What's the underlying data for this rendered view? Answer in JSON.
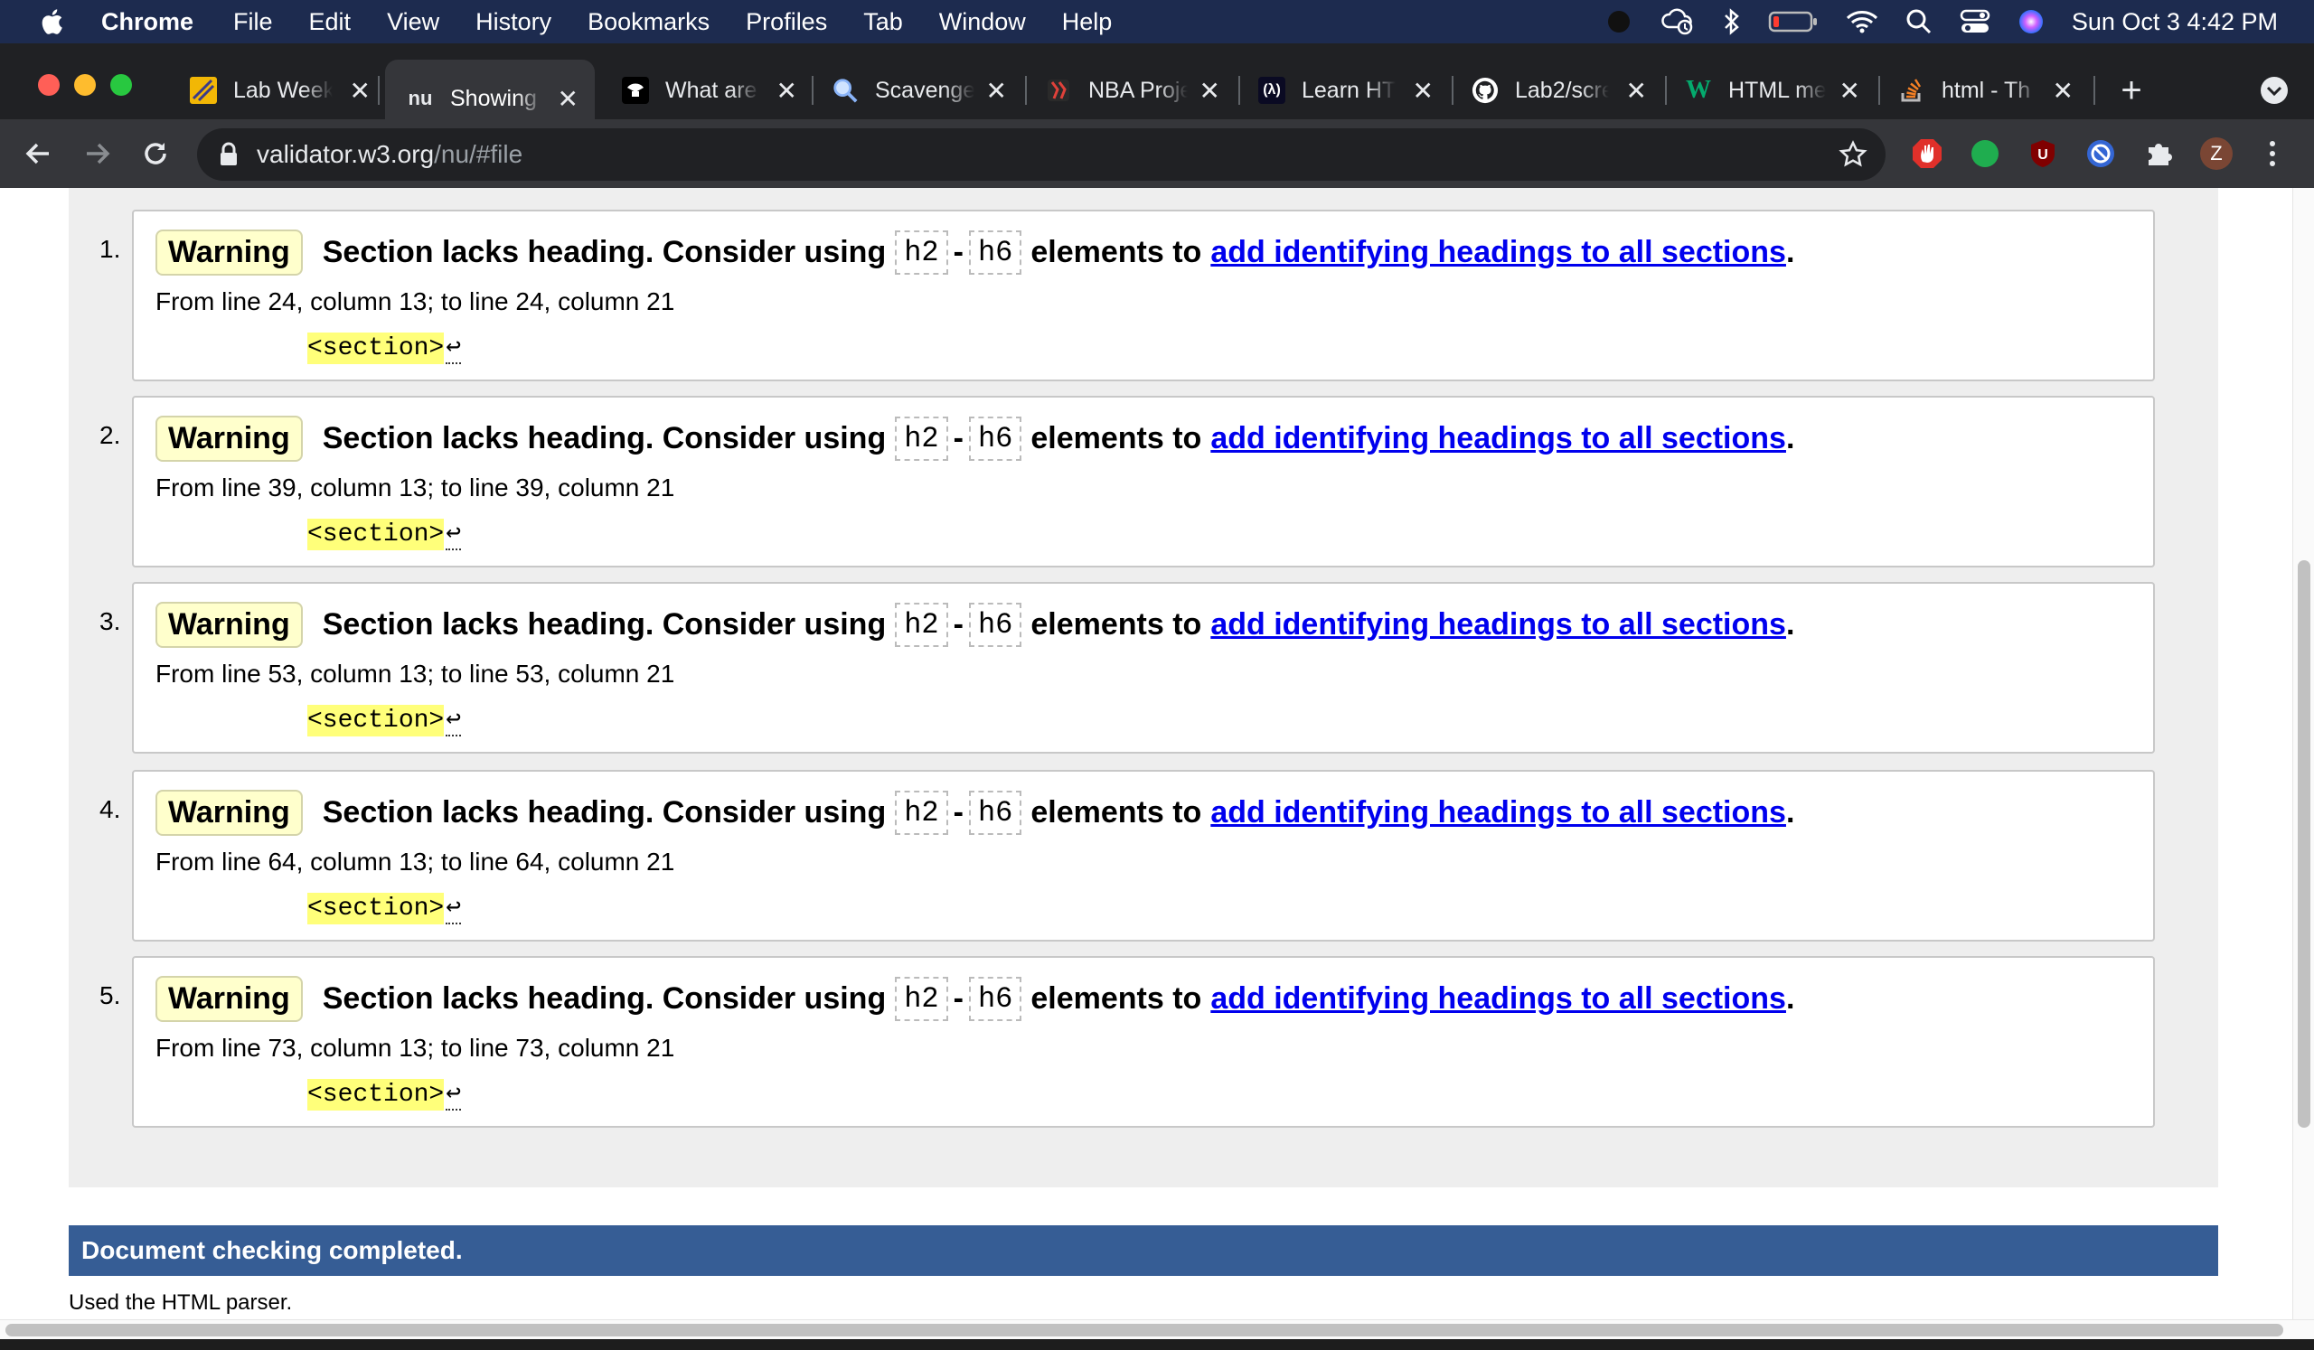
{
  "menubar": {
    "app_name": "Chrome",
    "items": [
      "File",
      "Edit",
      "View",
      "History",
      "Bookmarks",
      "Profiles",
      "Tab",
      "Window",
      "Help"
    ],
    "clock": "Sun Oct 3  4:42 PM"
  },
  "tabs": [
    {
      "title": "Lab Week",
      "icon": "lab-week-icon"
    },
    {
      "title": "Showing r",
      "icon": "nu-icon",
      "favicon_text": "nu",
      "active": true
    },
    {
      "title": "What are",
      "icon": "what-are-icon"
    },
    {
      "title": "Scavenge",
      "icon": "magnifier-icon"
    },
    {
      "title": "NBA Proje",
      "icon": "nba-icon"
    },
    {
      "title": "Learn HTI",
      "icon": "freecodecamp-icon",
      "favicon_text": "(λ)"
    },
    {
      "title": "Lab2/scre",
      "icon": "github-icon"
    },
    {
      "title": "HTML me",
      "icon": "w3schools-icon",
      "favicon_text": "W"
    },
    {
      "title": "html - Th",
      "icon": "stackoverflow-icon"
    }
  ],
  "toolbar": {
    "url_host": "validator.w3.org",
    "url_path": "/nu/#file",
    "profile_initial": "Z"
  },
  "messages": [
    {
      "num": "1.",
      "type": "Warning",
      "text_before": "Section lacks heading. Consider using",
      "code_a": "h2",
      "sep": "-",
      "code_b": "h6",
      "text_after": "elements to",
      "link": "add identifying headings to all sections",
      "period": ".",
      "location": "From line 24, column 13; to line 24, column 21",
      "extract": "<section>",
      "lf": "↩"
    },
    {
      "num": "2.",
      "type": "Warning",
      "text_before": "Section lacks heading. Consider using",
      "code_a": "h2",
      "sep": "-",
      "code_b": "h6",
      "text_after": "elements to",
      "link": "add identifying headings to all sections",
      "period": ".",
      "location": "From line 39, column 13; to line 39, column 21",
      "extract": "<section>",
      "lf": "↩"
    },
    {
      "num": "3.",
      "type": "Warning",
      "text_before": "Section lacks heading. Consider using",
      "code_a": "h2",
      "sep": "-",
      "code_b": "h6",
      "text_after": "elements to",
      "link": "add identifying headings to all sections",
      "period": ".",
      "location": "From line 53, column 13; to line 53, column 21",
      "extract": "<section>",
      "lf": "↩"
    },
    {
      "num": "4.",
      "type": "Warning",
      "text_before": "Section lacks heading. Consider using",
      "code_a": "h2",
      "sep": "-",
      "code_b": "h6",
      "text_after": "elements to",
      "link": "add identifying headings to all sections",
      "period": ".",
      "location": "From line 64, column 13; to line 64, column 21",
      "extract": "<section>",
      "lf": "↩"
    },
    {
      "num": "5.",
      "type": "Warning",
      "text_before": "Section lacks heading. Consider using",
      "code_a": "h2",
      "sep": "-",
      "code_b": "h6",
      "text_after": "elements to",
      "link": "add identifying headings to all sections",
      "period": ".",
      "location": "From line 73, column 13; to line 73, column 21",
      "extract": "<section>",
      "lf": "↩"
    }
  ],
  "footer": {
    "completed": "Document checking completed.",
    "parser_note": "Used the HTML parser."
  },
  "colors": {
    "menubar": "#1d2b4f",
    "tabstrip": "#202124",
    "toolbar": "#35363a",
    "warning_badge": "#ffffcc",
    "extract_highlight": "#ffff7a",
    "link": "#0000ee",
    "completed_bar": "#365d95"
  }
}
